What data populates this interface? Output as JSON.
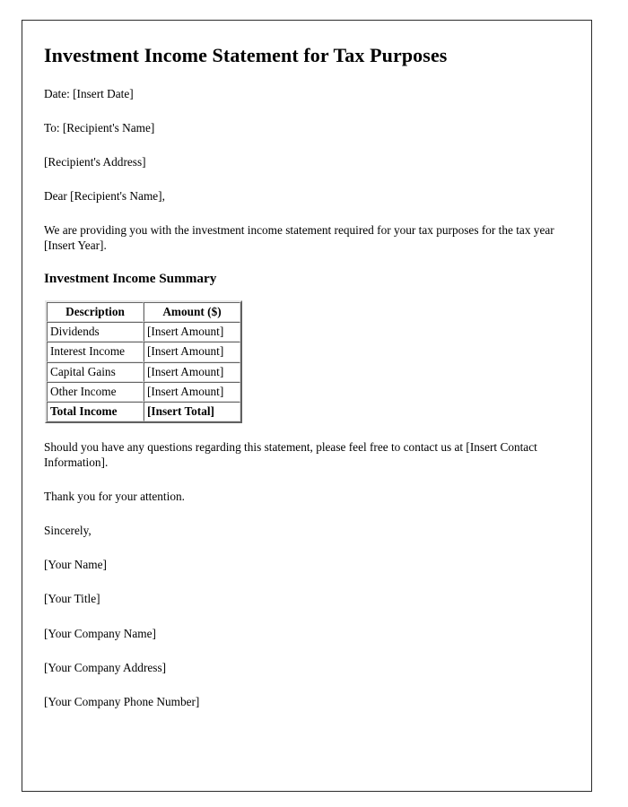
{
  "document": {
    "title": "Investment Income Statement for Tax Purposes",
    "date_line": "Date: [Insert Date]",
    "to_line": "To: [Recipient's Name]",
    "recipient_address": "[Recipient's Address]",
    "salutation": "Dear [Recipient's Name],",
    "intro_paragraph": "We are providing you with the investment income statement required for your tax purposes for the tax year [Insert Year].",
    "section_heading": "Investment Income Summary",
    "closing_paragraph": "Should you have any questions regarding this statement, please feel free to contact us at [Insert Contact Information].",
    "thanks_paragraph": "Thank you for your attention.",
    "sign_off": "Sincerely,",
    "signature_block": [
      "[Your Name]",
      "[Your Title]",
      "[Your Company Name]",
      "[Your Company Address]",
      "[Your Company Phone Number]"
    ]
  },
  "summary_table": {
    "headers": [
      "Description",
      "Amount ($)"
    ],
    "rows": [
      {
        "description": "Dividends",
        "amount": "[Insert Amount]"
      },
      {
        "description": "Interest Income",
        "amount": "[Insert Amount]"
      },
      {
        "description": "Capital Gains",
        "amount": "[Insert Amount]"
      },
      {
        "description": "Other Income",
        "amount": "[Insert Amount]"
      }
    ],
    "total_row": {
      "description": "Total Income",
      "amount": "[Insert Total]"
    }
  },
  "theme": {
    "page_background": "#ffffff",
    "text_color": "#000000",
    "frame_border_color": "#2b2b2b",
    "table_border_color": "#c8c8c8"
  }
}
